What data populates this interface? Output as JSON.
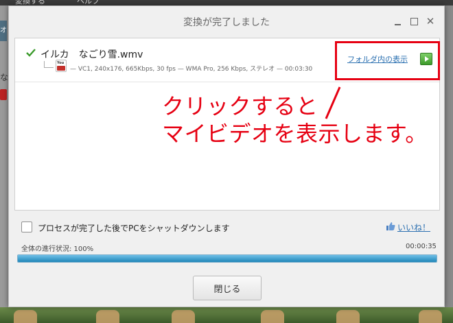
{
  "background": {
    "menu_items": [
      "変換する",
      "ヘルプ"
    ],
    "left_tab": "オ",
    "left_text": "な"
  },
  "dialog": {
    "title": "変換が完了しました"
  },
  "file": {
    "name": "イルカ　なごり雪.wmv",
    "info": "— VC1, 240x176, 665Kbps, 30 fps — WMA Pro, 256 Kbps, ステレオ — 00:03:30",
    "format_icon_text": "You",
    "open_folder_label": "フォルダ内の表示"
  },
  "annotation": {
    "line1": "クリックすると",
    "line2": "マイビデオを表示します。",
    "color": "#e60012"
  },
  "options": {
    "shutdown_label": "プロセスが完了した後でPCをシャットダウンします",
    "like_label": "いいね！"
  },
  "progress": {
    "label": "全体の進行状況: 100%",
    "percent": 100,
    "elapsed": "00:00:35"
  },
  "buttons": {
    "close_label": "閉じる"
  }
}
